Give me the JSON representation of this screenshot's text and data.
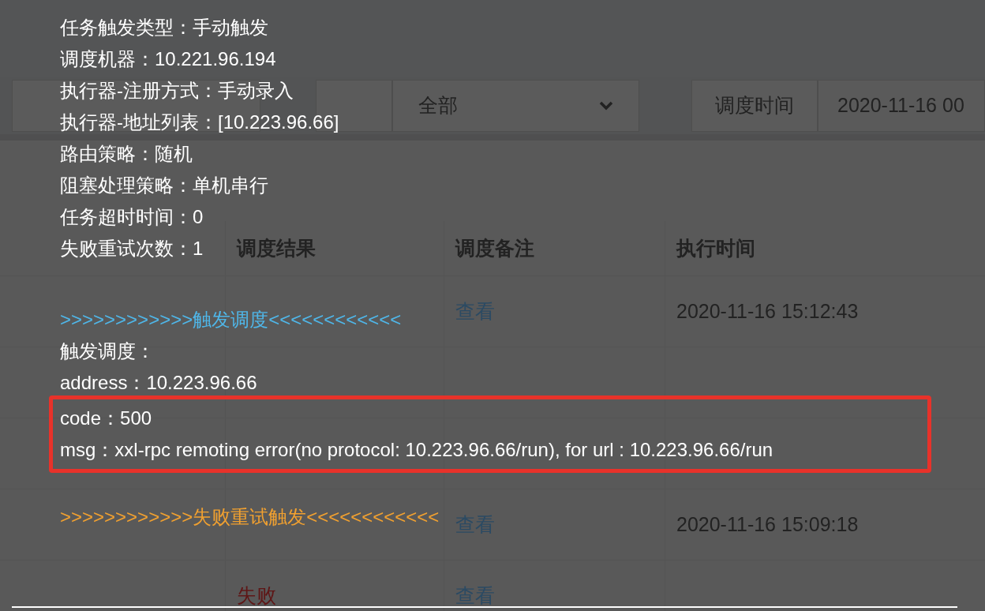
{
  "filters": {
    "status_select": {
      "value": "全部"
    },
    "time_label": "调度时间",
    "time_input": {
      "value": "2020-11-16 00"
    }
  },
  "table": {
    "columns": [
      "调度结果",
      "调度备注",
      "执行时间"
    ],
    "rows": [
      {
        "note": "查看",
        "time": "2020-11-16 15:12:43"
      },
      {},
      {},
      {
        "note": "查看",
        "time": "2020-11-16 15:09:18"
      },
      {
        "status": "失败",
        "color": "#5e1616",
        "note": "查看"
      }
    ]
  },
  "popup": {
    "details": [
      "任务触发类型：手动触发",
      "调度机器：10.221.96.194",
      "执行器-注册方式：手动录入",
      "执行器-地址列表：[10.223.96.66]",
      "路由策略：随机",
      "阻塞处理策略：单机串行",
      "任务超时时间：0",
      "失败重试次数：1"
    ],
    "trigger": {
      "header": ">>>>>>>>>>>>触发调度<<<<<<<<<<<<",
      "lines": [
        "触发调度：",
        "address：10.223.96.66"
      ]
    },
    "error": {
      "lines": [
        "code：500",
        "msg：xxl-rpc remoting error(no protocol: 10.223.96.66/run), for url : 10.223.96.66/run"
      ]
    },
    "retry_header": ">>>>>>>>>>>>失败重试触发<<<<<<<<<<<<"
  }
}
